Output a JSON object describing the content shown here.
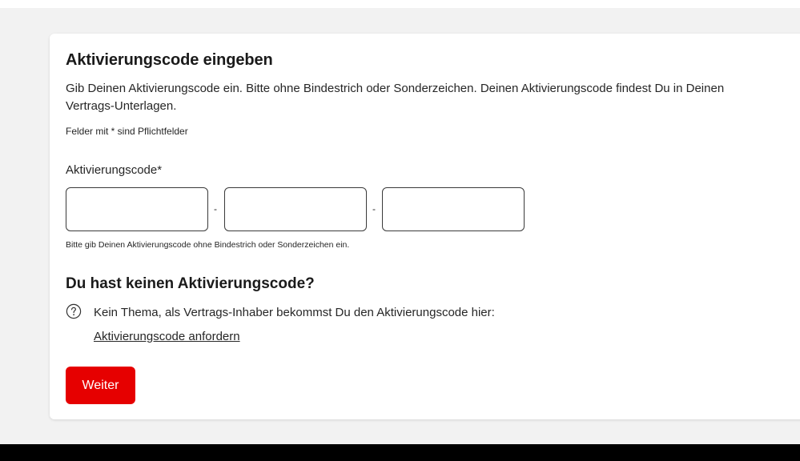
{
  "form": {
    "title": "Aktivierungscode eingeben",
    "intro": "Gib Deinen Aktivierungscode ein. Bitte ohne Bindestrich oder Sonderzeichen. Deinen Aktivierungscode findest Du in Deinen Vertrags-Unterlagen.",
    "required_note": "Felder mit * sind Pflichtfelder",
    "code_label": "Aktivierungscode*",
    "code_fields": [
      {
        "value": "",
        "placeholder": ""
      },
      {
        "value": "",
        "placeholder": ""
      },
      {
        "value": "",
        "placeholder": ""
      }
    ],
    "separator": "-",
    "hint": "Bitte gib Deinen Aktivierungscode ohne Bindestrich oder Sonderzeichen ein."
  },
  "no_code": {
    "title": "Du hast keinen Aktivierungscode?",
    "icon": "question-circle-icon",
    "text": "Kein Thema, als Vertrags-Inhaber bekommst Du den Aktivierungscode hier:",
    "link_label": "Aktivierungscode anfordern"
  },
  "actions": {
    "submit_label": "Weiter"
  },
  "colors": {
    "accent": "#e60000",
    "background": "#f2f2f2",
    "footer": "#000000"
  }
}
